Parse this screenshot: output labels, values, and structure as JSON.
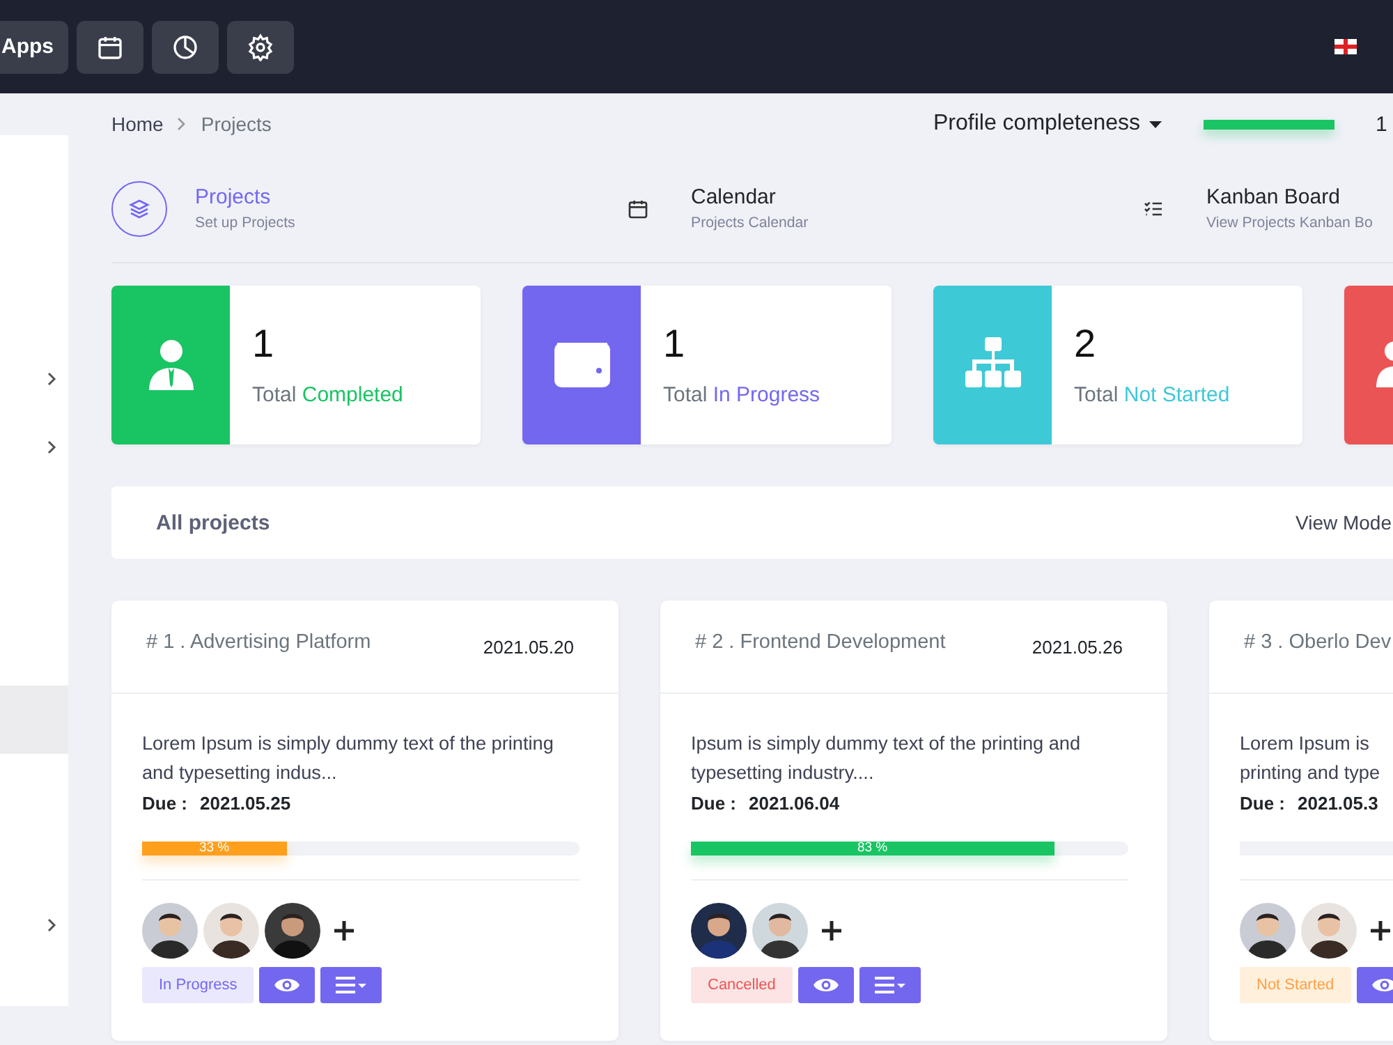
{
  "topbar": {
    "apps_label": "Apps",
    "tool_buttons": [
      {
        "kind": "calendar"
      },
      {
        "kind": "pie"
      },
      {
        "kind": "settings"
      }
    ]
  },
  "sidebar": {
    "items": [
      {
        "kind": "blank"
      },
      {
        "kind": "blank"
      },
      {
        "kind": "blank"
      },
      {
        "kind": "submenu"
      },
      {
        "kind": "submenu"
      },
      {
        "kind": "blank"
      },
      {
        "kind": "blank"
      },
      {
        "kind": "blank"
      },
      {
        "kind": "active"
      },
      {
        "kind": "blank"
      },
      {
        "kind": "blank"
      },
      {
        "kind": "submenu"
      }
    ]
  },
  "breadcrumb": [
    "Home",
    "Projects"
  ],
  "profile": {
    "label": "Profile completeness",
    "level": 1,
    "reading": "1"
  },
  "nav": [
    {
      "kind": "layers",
      "title": "Projects",
      "subtitle": "Set up Projects",
      "selected": true
    },
    {
      "kind": "calendar",
      "title": "Calendar",
      "subtitle": "Projects Calendar",
      "selected": false
    },
    {
      "kind": "checklist",
      "title": "Kanban Board",
      "subtitle": "View Projects Kanban Bo",
      "selected": false
    }
  ],
  "stats": [
    {
      "kind": "person",
      "color": "#19c463",
      "value": "1",
      "label": "Total",
      "highlight": "Completed"
    },
    {
      "kind": "wallet",
      "color": "#7367f0",
      "value": "1",
      "label": "Total",
      "highlight": "In Progress"
    },
    {
      "kind": "hierarchy",
      "color": "#3ec9d6",
      "value": "2",
      "label": "Total",
      "highlight": "Not Started"
    },
    {
      "kind": "group",
      "color": "#ea5455"
    }
  ],
  "all_projects": {
    "title": "All projects",
    "view_mode": "View Mode"
  },
  "projects": [
    {
      "title": "# 1 . Advertising Platform",
      "date": "2021.05.20",
      "description": "Lorem Ipsum is simply dummy text of the printing and typesetting indus...",
      "due_label": "Due :",
      "due": "2021.05.25",
      "level": 0.33,
      "progress_label": "33 %",
      "color": "#ff9f1c",
      "avatars": [
        {
          "kind": "picture"
        },
        {
          "kind": "picture"
        },
        {
          "kind": "picture"
        }
      ],
      "status": "In Progress",
      "kind": "in_progress"
    },
    {
      "title": "# 2 . Frontend Development",
      "date": "2021.05.26",
      "description": "Ipsum is simply dummy text of the printing and typesetting industry....",
      "due_label": "Due :",
      "due": "2021.06.04",
      "level": 0.83,
      "progress_label": "83 %",
      "color": "#19c463",
      "avatars": [
        {
          "kind": "picture"
        },
        {
          "kind": "picture"
        }
      ],
      "status": "Cancelled",
      "kind": "cancelled"
    },
    {
      "title": "# 3 . Oberlo Dev",
      "description_lines": [
        "Lorem Ipsum is",
        "printing and type"
      ],
      "due_label": "Due :",
      "due": "2021.05.3",
      "level": 0,
      "avatars": [
        {
          "kind": "picture"
        },
        {
          "kind": "picture"
        }
      ],
      "status": "Not Started",
      "kind": "not_started"
    }
  ]
}
